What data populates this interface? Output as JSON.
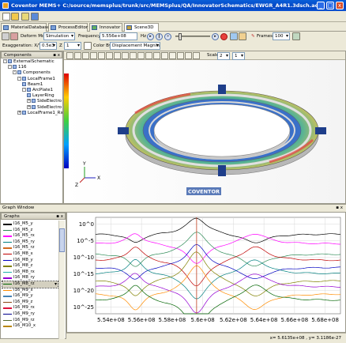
{
  "window": {
    "title": "Coventor MEMS+   C:/source/memsplus/trunk/src/MEMSplus/QA/InnovatorSchematics/EWGR_A4R1.3dsch.ac",
    "minimize": "_",
    "maximize": "□",
    "close": "x"
  },
  "tabs": [
    {
      "label": "MaterialDatabase"
    },
    {
      "label": "ProcessEditor"
    },
    {
      "label": "Innovator"
    },
    {
      "label": "Scene3D"
    }
  ],
  "controls": {
    "deform_mode_label": "Deform Mode",
    "deform_mode_value": "Simulation",
    "frequency_label": "Frequency",
    "frequency_value": "5.556e+08",
    "frequency_unit": "Hz",
    "frames_label": "Frames",
    "frames_value": "100",
    "exaggeration_label": "Exaggeration: X/Y",
    "exaggeration_xy": "0.5e3",
    "exaggeration_z": "1",
    "color_by_label": "Color By",
    "color_by_value": "Displacement Magnitude",
    "scale_label": "Scale",
    "scale_a": "2",
    "scale_b": "1"
  },
  "components_panel": {
    "title": "Components",
    "tree": [
      {
        "label": "ExternalSchematic",
        "depth": 0,
        "expander": "-"
      },
      {
        "label": "116",
        "depth": 1,
        "expander": "-"
      },
      {
        "label": "Components",
        "depth": 2,
        "expander": "-"
      },
      {
        "label": "LocalFrame1",
        "depth": 3,
        "expander": "-"
      },
      {
        "label": "Beam1",
        "depth": 4,
        "expander": ""
      },
      {
        "label": "ArcPlate1",
        "depth": 4,
        "expander": "-"
      },
      {
        "label": "LayerRing",
        "depth": 5,
        "expander": ""
      },
      {
        "label": "SideElectro",
        "depth": 5,
        "expander": "+"
      },
      {
        "label": "SideElectro",
        "depth": 5,
        "expander": "+"
      },
      {
        "label": "LocalFrame1_Rx",
        "depth": 3,
        "expander": "+"
      }
    ]
  },
  "viewport": {
    "watermark": "COVENTOR",
    "axes": {
      "x": "X",
      "y": "Y",
      "z": "Z"
    }
  },
  "graph_window": {
    "title": "Graph Window",
    "graphs_title": "Graphs",
    "items": [
      {
        "label": "I16_M5_y",
        "color": "#000000"
      },
      {
        "label": "I16_M5_z",
        "color": "#2e8b57"
      },
      {
        "label": "I16_M5_rx",
        "color": "#ff00ff"
      },
      {
        "label": "I16_M5_ry",
        "color": "#008080"
      },
      {
        "label": "I16_M5_rz",
        "color": "#d2691e"
      },
      {
        "label": "I16_M8_x",
        "color": "#c00000"
      },
      {
        "label": "I16_M8_y",
        "color": "#0000c0"
      },
      {
        "label": "I16_M8_z",
        "color": "#808000"
      },
      {
        "label": "I16_M8_rx",
        "color": "#20b2aa"
      },
      {
        "label": "I16_M8_ry",
        "color": "#9400d3"
      },
      {
        "label": "I16_M8_rz",
        "color": "#006400",
        "selected": true
      },
      {
        "label": "I16_M9_x",
        "color": "#ff8c00"
      },
      {
        "label": "I16_M9_y",
        "color": "#4682b4"
      },
      {
        "label": "I16_M9_z",
        "color": "#8b4513"
      },
      {
        "label": "I16_M9_rx",
        "color": "#dc143c"
      },
      {
        "label": "I16_M9_ry",
        "color": "#00008b"
      },
      {
        "label": "I16_M9_rz",
        "color": "#556b2f"
      },
      {
        "label": "I16_M10_x",
        "color": "#b8860b"
      }
    ],
    "status": "x= 5.6135e+08 , y= 3.1186e-27"
  },
  "chart_data": {
    "type": "line",
    "xlim": [
      553000000.0,
      569000000.0
    ],
    "ylim_log10": [
      -27,
      2
    ],
    "x_ticks": [
      "5.54e+08",
      "5.56e+08",
      "5.58e+08",
      "5.6e+08",
      "5.62e+08",
      "5.64e+08",
      "5.66e+08",
      "5.68e+08"
    ],
    "x_tick_values": [
      554000000.0,
      556000000.0,
      558000000.0,
      560000000.0,
      562000000.0,
      564000000.0,
      566000000.0,
      568000000.0
    ],
    "y_ticks": [
      "10^0",
      "10^-5",
      "10^-10",
      "10^-15",
      "10^-20",
      "10^-25"
    ],
    "y_tick_values_log10": [
      0,
      -5,
      -10,
      -15,
      -20,
      -25
    ],
    "resonances": [
      555600000.0,
      559600000.0,
      563400000.0
    ],
    "marker_x": 559600000.0,
    "grid": true,
    "series": [
      {
        "color": "#000000",
        "base": -3,
        "amp": 5
      },
      {
        "color": "#ff00ff",
        "base": -6,
        "amp": 6
      },
      {
        "color": "#2e8b57",
        "base": -9,
        "amp": 7
      },
      {
        "color": "#c00000",
        "base": -11,
        "amp": 8
      },
      {
        "color": "#0000c0",
        "base": -13,
        "amp": 7
      },
      {
        "color": "#008080",
        "base": -15,
        "amp": 8
      },
      {
        "color": "#808000",
        "base": -17,
        "amp": 9
      },
      {
        "color": "#9400d3",
        "base": -19,
        "amp": 8
      },
      {
        "color": "#ff8c00",
        "base": -21,
        "amp": 9
      },
      {
        "color": "#006400",
        "base": -23,
        "amp": 9
      }
    ]
  }
}
